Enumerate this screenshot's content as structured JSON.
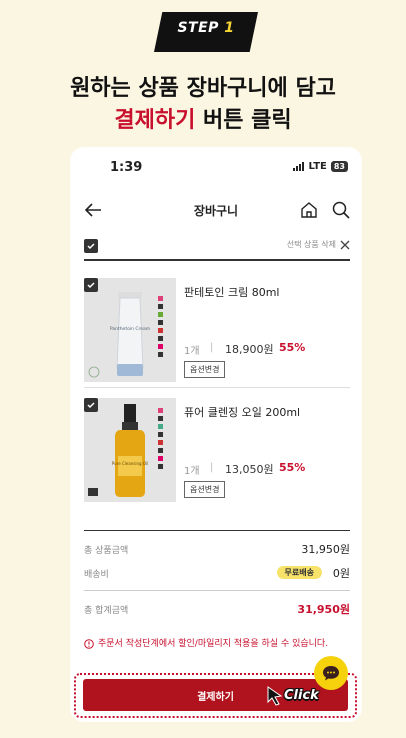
{
  "step": {
    "label": "STEP",
    "number": "1"
  },
  "headline": {
    "line1": "원하는 상품 장바구니에 담고",
    "line2_accent": "결제하기",
    "line2_rest": " 버튼 클릭"
  },
  "status_bar": {
    "time": "1:39",
    "network": "LTE",
    "battery": "83"
  },
  "header": {
    "title": "장바구니"
  },
  "select_bar": {
    "delete_label": "선택 상품 삭제"
  },
  "items": [
    {
      "name": "판테토인 크림 80ml",
      "qty": "1개",
      "price": "18,900원",
      "discount": "55%",
      "option_label": "옵션변경",
      "tube_text": "Panthetoin Cream"
    },
    {
      "name": "퓨어 클렌징 오일 200ml",
      "qty": "1개",
      "price": "13,050원",
      "discount": "55%",
      "option_label": "옵션변경",
      "bottle_text": "Pure Cleansing Oil"
    }
  ],
  "summary": {
    "subtotal_label": "총 상품금액",
    "subtotal_value": "31,950원",
    "shipping_label": "배송비",
    "shipping_badge": "무료배송",
    "shipping_value": "0원",
    "total_label": "총 합계금액",
    "total_value": "31,950원"
  },
  "notice": "주문서 작성단계에서 할인/마일리지 적용을 하실 수 있습니다.",
  "checkout": {
    "label": "결제하기",
    "click_label": "Click"
  },
  "colors": {
    "accent": "#c8102e",
    "background": "#fbf6e2",
    "badge": "#f7e36a",
    "chat": "#f5d20c"
  }
}
